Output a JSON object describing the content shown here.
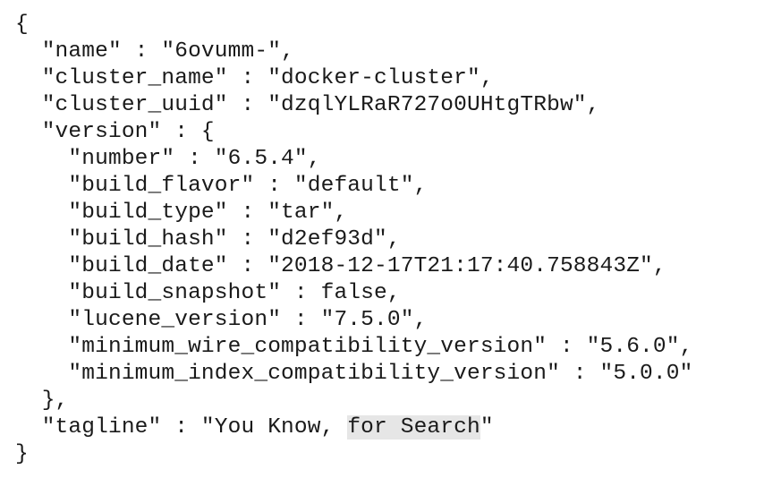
{
  "json_viewer": {
    "lines": [
      "{",
      "  \"name\" : \"6ovumm-\",",
      "  \"cluster_name\" : \"docker-cluster\",",
      "  \"cluster_uuid\" : \"dzqlYLRaR727o0UHtgTRbw\",",
      "  \"version\" : {",
      "    \"number\" : \"6.5.4\",",
      "    \"build_flavor\" : \"default\",",
      "    \"build_type\" : \"tar\",",
      "    \"build_hash\" : \"d2ef93d\",",
      "    \"build_date\" : \"2018-12-17T21:17:40.758843Z\",",
      "    \"build_snapshot\" : false,",
      "    \"lucene_version\" : \"7.5.0\",",
      "    \"minimum_wire_compatibility_version\" : \"5.6.0\",",
      "    \"minimum_index_compatibility_version\" : \"5.0.0\"",
      "  },"
    ],
    "tagline_line": {
      "prefix": "  \"tagline\" : \"You Know, ",
      "selected": "for Search",
      "suffix": "\""
    },
    "closing_line": "}"
  },
  "colors": {
    "text": "#1a1a1a",
    "selection": "#e6e6e6",
    "background": "#ffffff"
  }
}
